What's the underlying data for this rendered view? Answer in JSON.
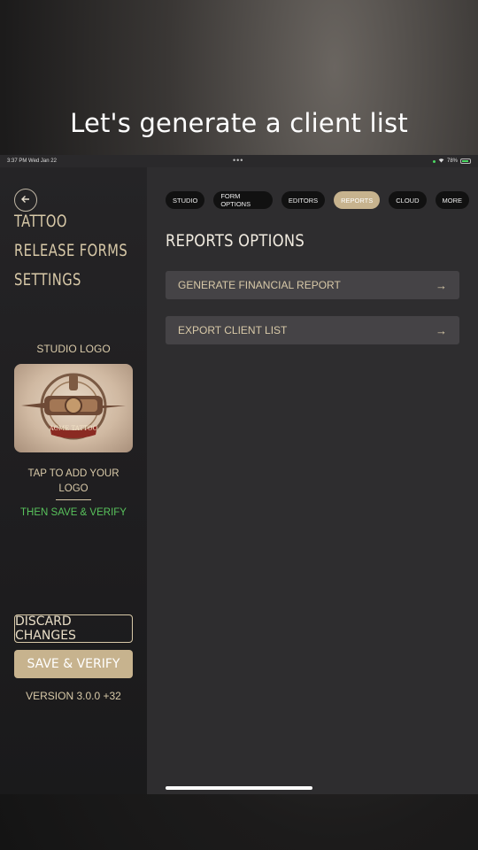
{
  "caption": "Let's generate a client list",
  "status_bar": {
    "time": "3:37 PM  Wed Jan 22",
    "dots": "•••",
    "battery": "78%"
  },
  "sidebar": {
    "title_lines": [
      "TATTOO",
      "RELEASE FORMS",
      "SETTINGS"
    ],
    "logo_label": "STUDIO LOGO",
    "logo_text": "ACME TATTOO",
    "tap_text_line1": "TAP TO ADD YOUR",
    "tap_text_line2": "LOGO",
    "then_text": "THEN SAVE & VERIFY",
    "discard_label": "DISCARD CHANGES",
    "save_label": "SAVE & VERIFY",
    "version": "VERSION 3.0.0 +32"
  },
  "tabs": [
    {
      "label": "STUDIO",
      "active": false
    },
    {
      "label": "FORM OPTIONS",
      "active": false
    },
    {
      "label": "EDITORS",
      "active": false
    },
    {
      "label": "REPORTS",
      "active": true
    },
    {
      "label": "CLOUD",
      "active": false
    },
    {
      "label": "MORE",
      "active": false
    }
  ],
  "main": {
    "title": "REPORTS OPTIONS",
    "options": [
      {
        "label": "GENERATE FINANCIAL REPORT",
        "arrow": "→"
      },
      {
        "label": "EXPORT CLIENT LIST",
        "arrow": "→"
      }
    ]
  },
  "colors": {
    "accent": "#c7b38e",
    "text_gold": "#d8c9a8",
    "green": "#58c25c",
    "panel": "#2e2d2f"
  }
}
